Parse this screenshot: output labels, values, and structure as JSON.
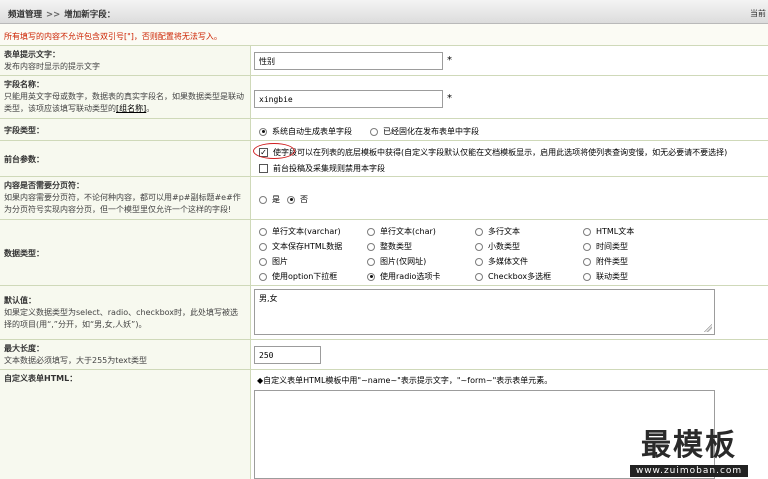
{
  "header": {
    "crumb_root": "频道管理",
    "crumb_sep": ">>",
    "crumb_current": "增加新字段：",
    "right_link": "当前"
  },
  "notice": "所有填写的内容不允许包含双引号[\"]，否则配置将无法写入。",
  "fields": {
    "prompt": {
      "title": "表单提示文字：",
      "desc": "发布内容时显示的提示文字",
      "value": "性别",
      "star": "*"
    },
    "name": {
      "title": "字段名称：",
      "desc": "只能用英文字母或数字，数据表的真实字段名，如果数据类型是联动类型，该项应该填写联动类型的",
      "link": "[组名称]",
      "desc_end": "。",
      "value": "xingbie",
      "star": "*"
    },
    "field_type": {
      "title": "字段类型：",
      "options": [
        "系统自动生成表单字段",
        "已经固化在发布表单中字段"
      ],
      "selected": 0
    },
    "front": {
      "title": "前台参数：",
      "checks": [
        {
          "label": "使字段可以在列表的底层模板中获得(自定义字段默认仅能在文档模板显示，启用此选项将使列表查询变慢，如无必要请不要选择)",
          "checked": true
        },
        {
          "label": "前台投稿及采集规则禁用本字段",
          "checked": false
        }
      ]
    },
    "paging": {
      "title": "内容是否需要分页符：",
      "desc": "如果内容需要分页符，不论何种内容，都可以用#p#副标题#e#作为分页符号实现内容分页，但一个模型里仅允许一个这样的字段!",
      "options": [
        "是",
        "否"
      ],
      "selected": 1
    },
    "data_type": {
      "title": "数据类型：",
      "options": [
        "单行文本(varchar)",
        "单行文本(char)",
        "多行文本",
        "HTML文本",
        "文本保存HTML数据",
        "整数类型",
        "小数类型",
        "时间类型",
        "图片",
        "图片(仅网址)",
        "多媒体文件",
        "附件类型",
        "使用option下拉框",
        "使用radio选项卡",
        "Checkbox多选框",
        "联动类型"
      ],
      "selected": 13
    },
    "default": {
      "title": "默认值：",
      "desc": "如果定义数据类型为select、radio、checkbox时，此处填写被选择的项目(用“,”分开，如“男,女,人妖”)。",
      "value": "男,女"
    },
    "maxlen": {
      "title": "最大长度：",
      "desc": "文本数据必须填写，大于255为text类型",
      "value": "250"
    },
    "custom_html": {
      "title": "自定义表单HTML：",
      "hint": "◆自定义表单HTML模板中用\"~name~\"表示提示文字，\"~form~\"表示表单元素。"
    }
  },
  "watermark": {
    "logo": "最模板",
    "url": "www.zuimoban.com"
  }
}
